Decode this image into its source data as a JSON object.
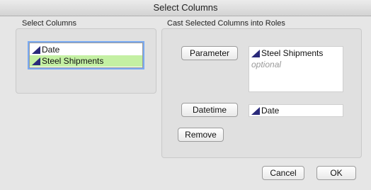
{
  "window": {
    "title": "Select Columns"
  },
  "select_columns": {
    "label": "Select Columns",
    "items": [
      {
        "name": "Date",
        "selected": false,
        "icon": "continuous-column-icon"
      },
      {
        "name": "Steel Shipments",
        "selected": true,
        "icon": "continuous-column-icon"
      }
    ]
  },
  "cast_roles": {
    "label": "Cast Selected Columns into Roles",
    "parameter": {
      "button_label": "Parameter",
      "value": "Steel Shipments",
      "hint": "optional",
      "icon": "continuous-column-icon"
    },
    "datetime": {
      "button_label": "Datetime",
      "value": "Date",
      "icon": "continuous-column-icon"
    },
    "remove_label": "Remove"
  },
  "footer": {
    "cancel_label": "Cancel",
    "ok_label": "OK"
  },
  "colors": {
    "selection": "#c4f0a3",
    "focus_ring": "#7aaaf2",
    "icon": "#2a2a7a"
  }
}
